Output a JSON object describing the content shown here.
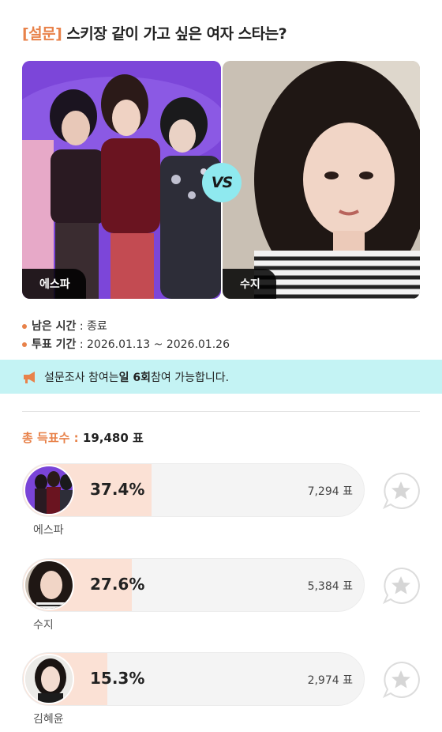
{
  "survey": {
    "tag": "[설문]",
    "question": "스키장 같이 가고 싶은 여자 스타는?"
  },
  "matchup": {
    "left_label": "에스파",
    "right_label": "수지",
    "vs_text": "VS"
  },
  "info": {
    "remaining_label": "남은 시간",
    "remaining_value": ": 종료",
    "period_label": "투표 기간",
    "period_value": ": 2026.01.13 ~ 2026.01.26"
  },
  "notice": {
    "prefix": "설문조사 참여는 ",
    "emphasis": "일 6회",
    "suffix": " 참여 가능합니다."
  },
  "total": {
    "label": "총 득표수 :",
    "value": "19,480 표"
  },
  "results": [
    {
      "name": "에스파",
      "percent": "37.4%",
      "votes": "7,294 표",
      "share": 0.374
    },
    {
      "name": "수지",
      "percent": "27.6%",
      "votes": "5,384 표",
      "share": 0.276
    },
    {
      "name": "김혜윤",
      "percent": "15.3%",
      "votes": "2,974 표",
      "share": 0.153
    }
  ],
  "colors": {
    "accent": "#e8824a",
    "notice_bg": "#c4f3f4",
    "vs_badge": "#8fe9ef",
    "bar_fill": "#fbe1d5"
  }
}
